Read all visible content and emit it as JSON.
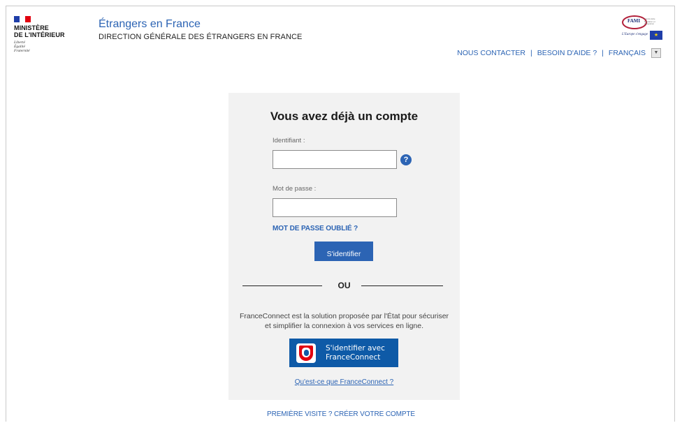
{
  "header": {
    "ministry": {
      "line1": "MINISTÈRE",
      "line2": "DE L'INTÉRIEUR",
      "motto": [
        "Liberté",
        "Égalité",
        "Fraternité"
      ]
    },
    "site_title": "Étrangers en France",
    "site_subtitle": "DIRECTION GÉNÉRALE DES ÉTRANGERS EN FRANCE",
    "partner_logo": {
      "name": "FAMI",
      "slogan": "L'Europe s'engage",
      "fine_print": "Fonds Asile Migration et Intégration"
    },
    "nav": {
      "contact": "NOUS CONTACTER",
      "separator": "|",
      "help": "BESOIN D'AIDE ?",
      "language": "FRANÇAIS"
    }
  },
  "login": {
    "title": "Vous avez déjà un compte",
    "username_label": "Identifiant :",
    "username_value": "",
    "password_label": "Mot de passe :",
    "password_value": "",
    "forgot_password": "MOT DE PASSE OUBLIÉ ?",
    "submit": "S'identifier",
    "or": "OU",
    "franceconnect_desc_line1": "FranceConnect est la solution proposée par l'État pour sécuriser",
    "franceconnect_desc_line2": "et simplifier la connexion à vos services en ligne.",
    "franceconnect_button_line1": "S'identifier avec",
    "franceconnect_button_line2": "FranceConnect",
    "franceconnect_info_link": "Qu'est-ce que FranceConnect ?"
  },
  "footer": {
    "first_visit": "PREMIÈRE VISITE ? CRÉER VOTRE COMPTE"
  },
  "icons": {
    "help": "question-circle-icon",
    "language_dropdown": "chevron-down-icon"
  },
  "colors": {
    "primary_blue": "#2c64b4",
    "franceconnect_blue": "#0e5aa7",
    "panel_bg": "#f2f2f2"
  }
}
